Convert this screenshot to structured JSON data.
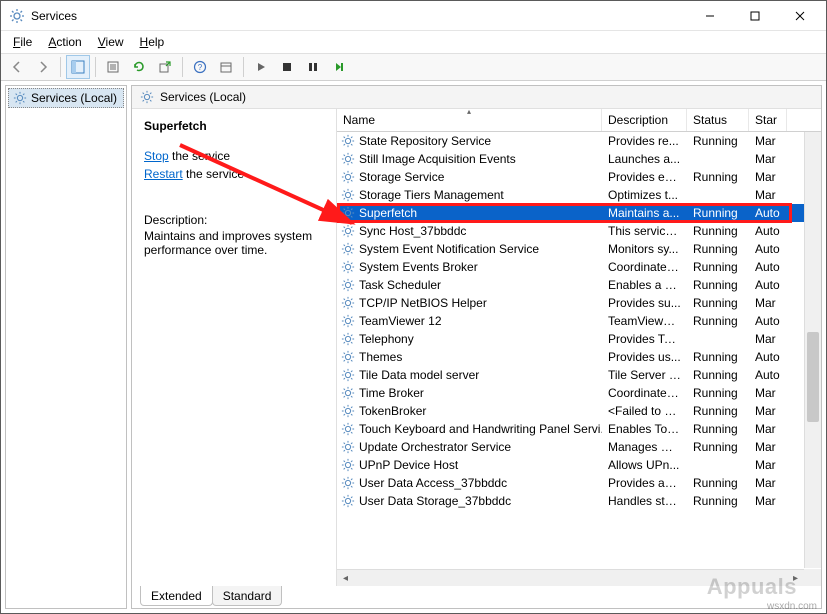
{
  "window": {
    "title": "Services"
  },
  "menu": {
    "file": "File",
    "action": "Action",
    "view": "View",
    "help": "Help"
  },
  "tree": {
    "root": "Services (Local)"
  },
  "right_header": "Services (Local)",
  "detail": {
    "name": "Superfetch",
    "stop_link": "Stop",
    "stop_suffix": " the service",
    "restart_link": "Restart",
    "restart_suffix": " the service",
    "desc_label": "Description:",
    "desc_text": "Maintains and improves system performance over time."
  },
  "columns": {
    "name": "Name",
    "description": "Description",
    "status": "Status",
    "startup": "Star"
  },
  "tabs": {
    "extended": "Extended",
    "standard": "Standard"
  },
  "services": [
    {
      "name": "State Repository Service",
      "desc": "Provides re...",
      "status": "Running",
      "start": "Mar"
    },
    {
      "name": "Still Image Acquisition Events",
      "desc": "Launches a...",
      "status": "",
      "start": "Mar"
    },
    {
      "name": "Storage Service",
      "desc": "Provides en...",
      "status": "Running",
      "start": "Mar"
    },
    {
      "name": "Storage Tiers Management",
      "desc": "Optimizes t...",
      "status": "",
      "start": "Mar"
    },
    {
      "name": "Superfetch",
      "desc": "Maintains a...",
      "status": "Running",
      "start": "Auto",
      "selected": true
    },
    {
      "name": "Sync Host_37bbddc",
      "desc": "This service ...",
      "status": "Running",
      "start": "Auto"
    },
    {
      "name": "System Event Notification Service",
      "desc": "Monitors sy...",
      "status": "Running",
      "start": "Auto"
    },
    {
      "name": "System Events Broker",
      "desc": "Coordinates...",
      "status": "Running",
      "start": "Auto"
    },
    {
      "name": "Task Scheduler",
      "desc": "Enables a us...",
      "status": "Running",
      "start": "Auto"
    },
    {
      "name": "TCP/IP NetBIOS Helper",
      "desc": "Provides su...",
      "status": "Running",
      "start": "Mar"
    },
    {
      "name": "TeamViewer 12",
      "desc": "TeamViewer...",
      "status": "Running",
      "start": "Auto"
    },
    {
      "name": "Telephony",
      "desc": "Provides Tel...",
      "status": "",
      "start": "Mar"
    },
    {
      "name": "Themes",
      "desc": "Provides us...",
      "status": "Running",
      "start": "Auto"
    },
    {
      "name": "Tile Data model server",
      "desc": "Tile Server f...",
      "status": "Running",
      "start": "Auto"
    },
    {
      "name": "Time Broker",
      "desc": "Coordinates...",
      "status": "Running",
      "start": "Mar"
    },
    {
      "name": "TokenBroker",
      "desc": "<Failed to R...",
      "status": "Running",
      "start": "Mar"
    },
    {
      "name": "Touch Keyboard and Handwriting Panel Servi...",
      "desc": "Enables Tou...",
      "status": "Running",
      "start": "Mar"
    },
    {
      "name": "Update Orchestrator Service",
      "desc": "Manages W...",
      "status": "Running",
      "start": "Mar"
    },
    {
      "name": "UPnP Device Host",
      "desc": "Allows UPn...",
      "status": "",
      "start": "Mar"
    },
    {
      "name": "User Data Access_37bbddc",
      "desc": "Provides ap...",
      "status": "Running",
      "start": "Mar"
    },
    {
      "name": "User Data Storage_37bbddc",
      "desc": "Handles sto...",
      "status": "Running",
      "start": "Mar"
    }
  ],
  "watermark": {
    "brand": "Appuals",
    "url": "wsxdn.com"
  }
}
